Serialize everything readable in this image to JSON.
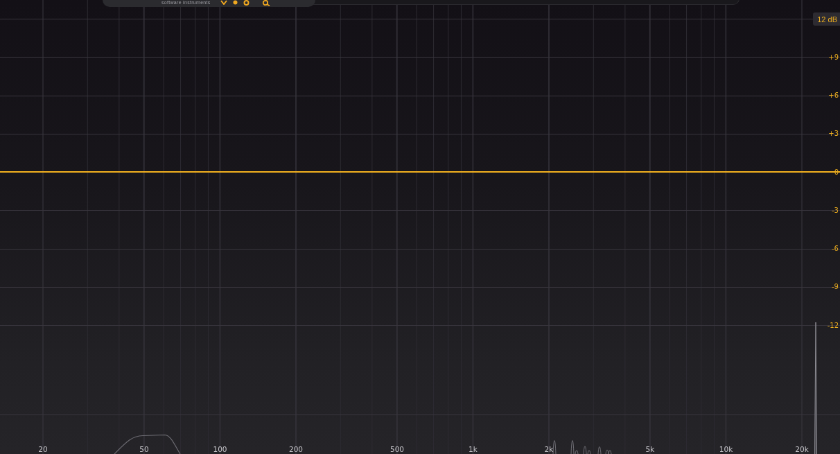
{
  "header": {
    "tagline": "software instruments"
  },
  "range_button": {
    "label": "12 dB"
  },
  "analyzer": {
    "chart_data": {
      "type": "line",
      "grid": true,
      "categories": [
        "20",
        null,
        null,
        null,
        "50",
        null,
        null,
        "100",
        null,
        null,
        "200",
        null,
        null,
        null,
        "500",
        null,
        null,
        "1k",
        null,
        null,
        "2k",
        null,
        null,
        null,
        "5k",
        null,
        null,
        "10k",
        null,
        null,
        "20k"
      ],
      "series": [
        {
          "color": "#f2b01e",
          "values": [
            0,
            0,
            0,
            0,
            0,
            0,
            0,
            0,
            0,
            0,
            0,
            0,
            0,
            0,
            0,
            0,
            0,
            0,
            0,
            0,
            0,
            0,
            0,
            0,
            0,
            0,
            0,
            0,
            0,
            0,
            0
          ]
        }
      ],
      "ylim": [
        -22.1,
        13.47
      ],
      "yticks": [
        {
          "value": 9,
          "label": "+9"
        },
        {
          "value": 6,
          "label": "+6"
        },
        {
          "value": 3,
          "label": "+3"
        },
        {
          "value": 0,
          "label": "0"
        },
        {
          "value": -3,
          "label": "-3"
        },
        {
          "value": -6,
          "label": "-6"
        },
        {
          "value": -9,
          "label": "-9"
        },
        {
          "value": -12,
          "label": "-12"
        }
      ]
    }
  }
}
